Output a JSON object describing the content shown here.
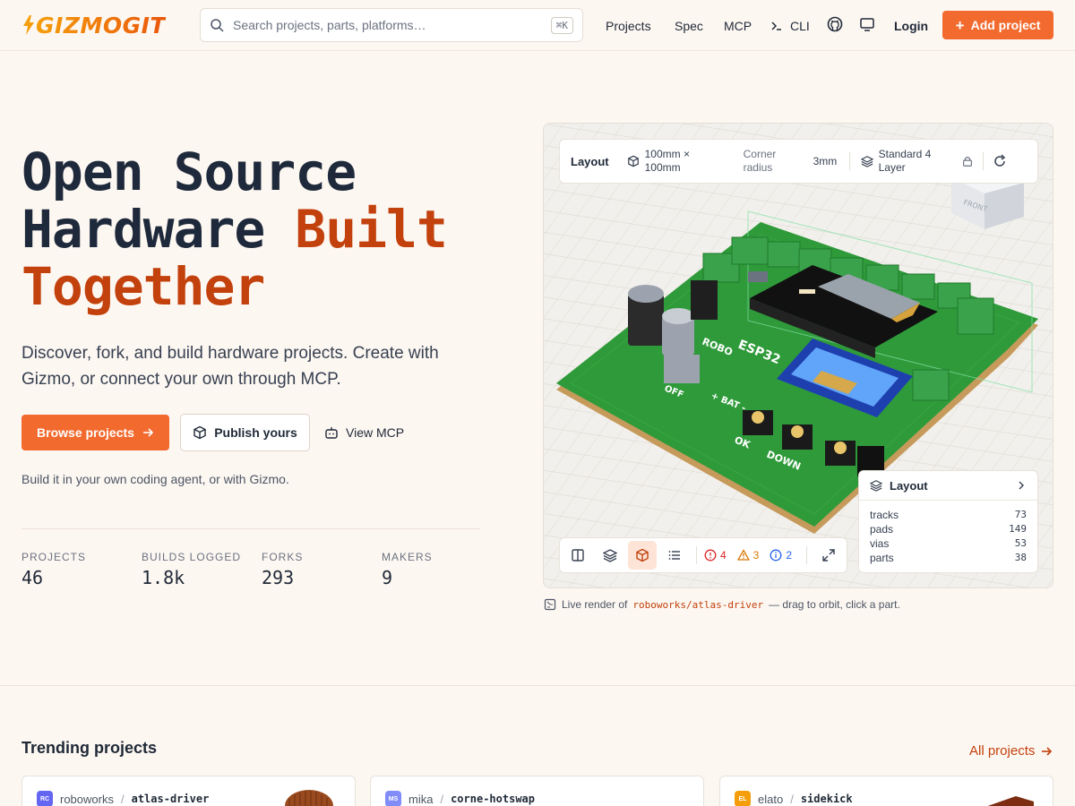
{
  "header": {
    "logo_text": "GIZMOGIT",
    "search": {
      "placeholder": "Search projects, parts, platforms…",
      "shortcut": "⌘K"
    },
    "nav": [
      "Projects",
      "Spec",
      "MCP",
      "CLI"
    ],
    "login": "Login",
    "add_project": "Add project"
  },
  "hero": {
    "title_line1": "Open Source",
    "title_line2_a": "Hardware ",
    "title_line2_b": "Built",
    "title_line3": "Together",
    "subtitle": "Discover, fork, and build hardware projects. Create with Gizmo, or connect your own through MCP.",
    "buttons": {
      "browse": "Browse projects",
      "publish": "Publish yours",
      "mcp": "View MCP"
    },
    "agent_note": "Build it in your own coding agent, or with Gizmo."
  },
  "stats": [
    {
      "label": "PROJECTS",
      "value": "46"
    },
    {
      "label": "BUILDS LOGGED",
      "value": "1.8k"
    },
    {
      "label": "FORKS",
      "value": "293"
    },
    {
      "label": "MAKERS",
      "value": "9"
    }
  ],
  "viewer": {
    "layout_bar": {
      "title": "Layout",
      "dimensions": "100mm × 100mm",
      "corner_label": "Corner radius",
      "corner_value": "3mm",
      "stackup": "Standard 4 Layer"
    },
    "diagnostics": {
      "errors": "4",
      "warnings": "3",
      "info": "2"
    },
    "layout_panel": {
      "title": "Layout",
      "rows": [
        {
          "label": "tracks",
          "value": "73"
        },
        {
          "label": "pads",
          "value": "149"
        },
        {
          "label": "vias",
          "value": "53"
        },
        {
          "label": "parts",
          "value": "38"
        }
      ]
    },
    "board_labels": [
      "ESP32",
      "ROBO",
      "OFF",
      "+ BAT -",
      "OK",
      "DOWN",
      "FRONT"
    ],
    "caption_prefix": "Live render of",
    "caption_link": "roboworks/atlas-driver",
    "caption_suffix": "— drag to orbit, click a part."
  },
  "trending": {
    "title": "Trending projects",
    "all_link": "All projects",
    "cards": [
      {
        "initials": "RC",
        "owner": "roboworks",
        "repo": "atlas-driver",
        "color": "#6366f1"
      },
      {
        "initials": "MS",
        "owner": "mika",
        "repo": "corne-hotswap",
        "color": "#818cf8"
      },
      {
        "initials": "EL",
        "owner": "elato",
        "repo": "sidekick",
        "color": "#f59e0b"
      }
    ]
  },
  "colors": {
    "accent": "#f26a2e",
    "accent_text": "#c2410c",
    "board_green": "#2f9a3a"
  }
}
